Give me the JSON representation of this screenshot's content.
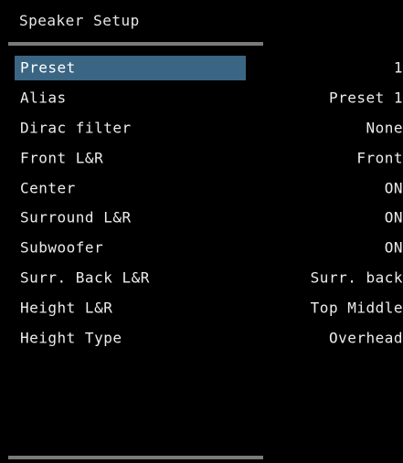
{
  "header": {
    "title": "Speaker Setup"
  },
  "menu": {
    "items": [
      {
        "label": "Preset",
        "value": "1",
        "selected": true
      },
      {
        "label": "Alias",
        "value": "Preset 1",
        "selected": false
      },
      {
        "label": "Dirac filter",
        "value": "None",
        "selected": false
      },
      {
        "label": "Front L&R",
        "value": "Front",
        "selected": false
      },
      {
        "label": "Center",
        "value": "ON",
        "selected": false
      },
      {
        "label": "Surround L&R",
        "value": "ON",
        "selected": false
      },
      {
        "label": "Subwoofer",
        "value": "ON",
        "selected": false
      },
      {
        "label": "Surr. Back L&R",
        "value": "Surr. back",
        "selected": false
      },
      {
        "label": "Height L&R",
        "value": "Top Middle",
        "selected": false
      },
      {
        "label": "Height Type",
        "value": "Overhead",
        "selected": false
      }
    ]
  },
  "colors": {
    "background": "#000000",
    "selection": "#3a6583",
    "divider": "#7a7a7a",
    "text": "#ececec"
  }
}
